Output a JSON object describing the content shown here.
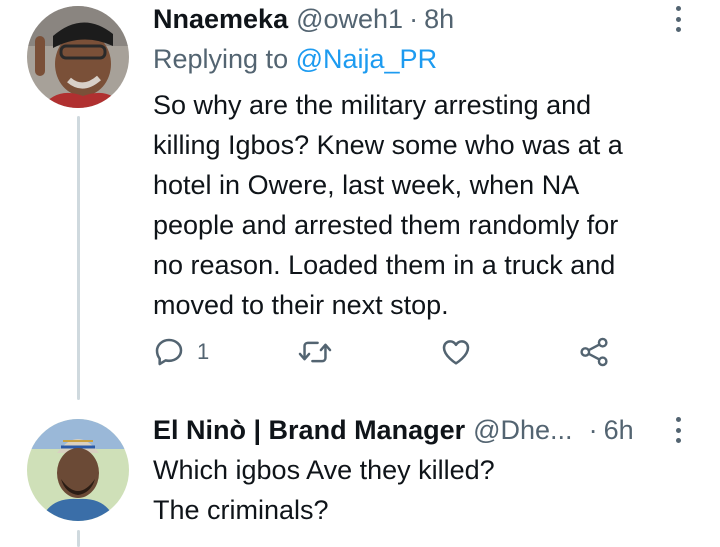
{
  "tweet1": {
    "name": "Nnaemeka",
    "handle": "@oweh1",
    "separator": "·",
    "time": "8h",
    "reply_prefix": "Replying to",
    "reply_to": "@Naija_PR",
    "text": "So why are the military arresting and\nkilling Igbos? Knew some who  was at a\nhotel in Owere, last week, when NA\npeople and arrested them randomly for\nno reason. Loaded them in a truck and\nmoved to their next stop.",
    "actions": {
      "reply_icon": "reply-icon",
      "reply_count": "1",
      "retweet_icon": "retweet-icon",
      "like_icon": "heart-icon",
      "share_icon": "share-icon"
    }
  },
  "tweet2": {
    "name": "El Ninò | Brand Manager",
    "handle": "@Dhe...",
    "separator": "·",
    "time": "6h",
    "text": "Which igbos Ave they killed?\nThe criminals?"
  },
  "colors": {
    "text": "#0f1419",
    "secondary": "#536471",
    "link": "#1d9bf0",
    "thread_line": "#cfd9de"
  }
}
